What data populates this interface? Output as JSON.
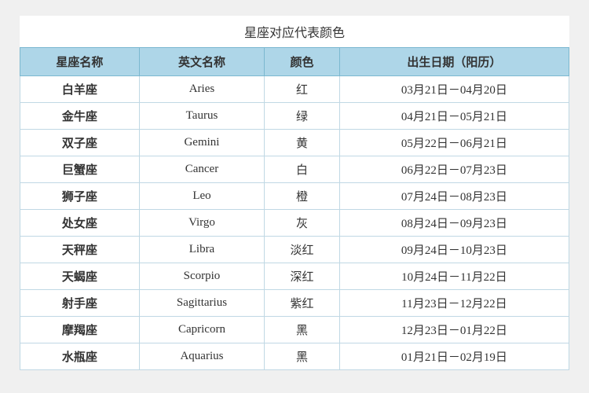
{
  "title": "星座对应代表颜色",
  "table": {
    "headers": [
      "星座名称",
      "英文名称",
      "颜色",
      "出生日期（阳历）"
    ],
    "rows": [
      [
        "白羊座",
        "Aries",
        "红",
        "03月21日－04月20日"
      ],
      [
        "金牛座",
        "Taurus",
        "绿",
        "04月21日－05月21日"
      ],
      [
        "双子座",
        "Gemini",
        "黄",
        "05月22日－06月21日"
      ],
      [
        "巨蟹座",
        "Cancer",
        "白",
        "06月22日－07月23日"
      ],
      [
        "狮子座",
        "Leo",
        "橙",
        "07月24日－08月23日"
      ],
      [
        "处女座",
        "Virgo",
        "灰",
        "08月24日－09月23日"
      ],
      [
        "天秤座",
        "Libra",
        "淡红",
        "09月24日－10月23日"
      ],
      [
        "天蝎座",
        "Scorpio",
        "深红",
        "10月24日－11月22日"
      ],
      [
        "射手座",
        "Sagittarius",
        "紫红",
        "11月23日－12月22日"
      ],
      [
        "摩羯座",
        "Capricorn",
        "黑",
        "12月23日－01月22日"
      ],
      [
        "水瓶座",
        "Aquarius",
        "黑",
        "01月21日－02月19日"
      ]
    ]
  }
}
